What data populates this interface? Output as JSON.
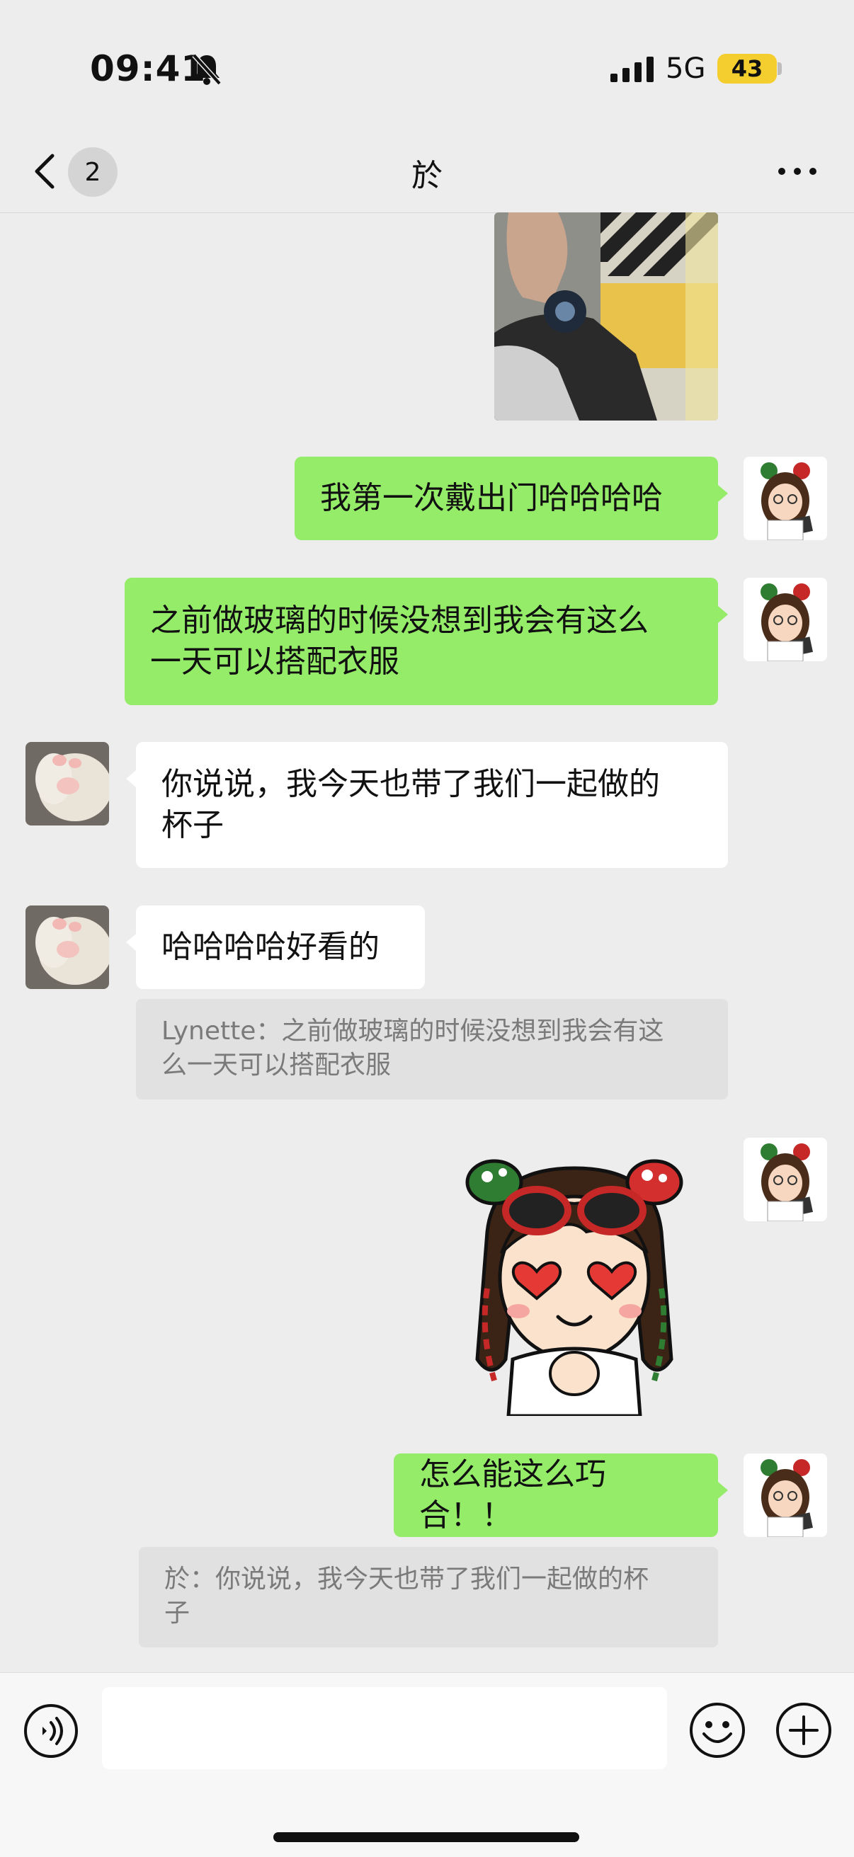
{
  "status": {
    "time": "09:41",
    "network": "5G",
    "battery": "43"
  },
  "nav": {
    "back_count": "2",
    "title": "於"
  },
  "messages": [
    {
      "from": "me",
      "type": "image"
    },
    {
      "from": "me",
      "text": "我第一次戴出门哈哈哈哈"
    },
    {
      "from": "me",
      "text_line1": "之前做玻璃的时候没想到我会有这么",
      "text_line2": "一天可以搭配衣服"
    },
    {
      "from": "other",
      "text_line1": "你说说，我今天也带了我们一起做的",
      "text_line2": "杯子"
    },
    {
      "from": "other",
      "text": "哈哈哈哈好看的",
      "quote_line1": "Lynette：之前做玻璃的时候没想到我会有这",
      "quote_line2": "么一天可以搭配衣服"
    },
    {
      "from": "me",
      "type": "sticker"
    },
    {
      "from": "me",
      "text": "怎么能这么巧合！！",
      "quote_line1": "於：你说说，我今天也带了我们一起做的杯",
      "quote_line2": "子"
    }
  ],
  "colors": {
    "my_bubble": "#95ec69",
    "other_bubble": "#ffffff",
    "background": "#ededed",
    "battery": "#f4ce2f"
  },
  "icons": [
    "bell-slash-icon",
    "signal-icon",
    "chevron-left-icon",
    "more-icon",
    "voice-icon",
    "emoji-icon",
    "plus-icon"
  ]
}
